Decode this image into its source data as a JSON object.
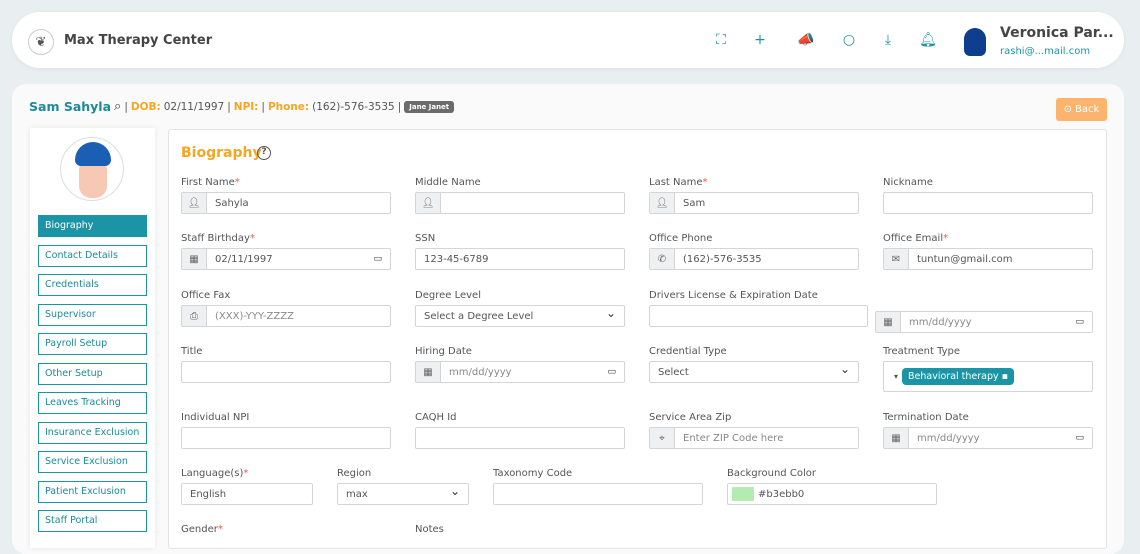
{
  "app": {
    "title": "Max Therapy Center"
  },
  "user": {
    "name": "Veronica Par...",
    "email": "rashi@...mail.com"
  },
  "topbar_icons": [
    "fullscreen-icon",
    "plus-icon",
    "megaphone-icon",
    "chat-icon",
    "download-icon",
    "bell-icon"
  ],
  "patient": {
    "name": "Sam Sahyla",
    "dob_label": "DOB:",
    "dob": "02/11/1997",
    "npi_label": "NPI:",
    "phone_label": "Phone:",
    "phone": "(162)-576-3535",
    "badge": "Jane Janet",
    "sep": "|"
  },
  "back_label": "Back",
  "sidebar": [
    "Biography",
    "Contact Details",
    "Credentials",
    "Supervisor",
    "Payroll Setup",
    "Other Setup",
    "Leaves Tracking",
    "Insurance Exclusion",
    "Service Exclusion",
    "Patient Exclusion",
    "Staff Portal"
  ],
  "section_title": "Biography",
  "help": "?",
  "fields": {
    "first_name": {
      "label": "First Name",
      "value": "Sahyla"
    },
    "middle_name": {
      "label": "Middle Name",
      "value": ""
    },
    "last_name": {
      "label": "Last Name",
      "value": "Sam"
    },
    "nickname": {
      "label": "Nickname",
      "value": ""
    },
    "birthday": {
      "label": "Staff Birthday",
      "value": "02/11/1997"
    },
    "ssn": {
      "label": "SSN",
      "value": "123-45-6789"
    },
    "office_phone": {
      "label": "Office Phone",
      "value": "(162)-576-3535"
    },
    "office_email": {
      "label": "Office Email",
      "value": "tuntun@gmail.com"
    },
    "office_fax": {
      "label": "Office Fax",
      "placeholder": "(XXX)-YYY-ZZZZ"
    },
    "degree": {
      "label": "Degree Level",
      "value": "Select a Degree Level"
    },
    "license": {
      "label": "Drivers License & Expiration Date",
      "date_placeholder": "mm/dd/yyyy"
    },
    "title": {
      "label": "Title",
      "value": ""
    },
    "hiring": {
      "label": "Hiring Date",
      "placeholder": "mm/dd/yyyy"
    },
    "credential_type": {
      "label": "Credential Type",
      "value": "Select"
    },
    "treatment_type": {
      "label": "Treatment Type",
      "tag": "Behavioral therapy"
    },
    "npi": {
      "label": "Individual NPI",
      "value": ""
    },
    "caqh": {
      "label": "CAQH Id",
      "value": ""
    },
    "zip": {
      "label": "Service Area Zip",
      "placeholder": "Enter ZIP Code here"
    },
    "termination": {
      "label": "Termination Date",
      "placeholder": "mm/dd/yyyy"
    },
    "language": {
      "label": "Language(s)",
      "value": "English"
    },
    "region": {
      "label": "Region",
      "value": "max"
    },
    "taxonomy": {
      "label": "Taxonomy Code",
      "value": ""
    },
    "bgcolor": {
      "label": "Background Color",
      "value": "#b3ebb0"
    },
    "gender": {
      "label": "Gender"
    },
    "notes": {
      "label": "Notes"
    }
  },
  "required_mark": "*"
}
